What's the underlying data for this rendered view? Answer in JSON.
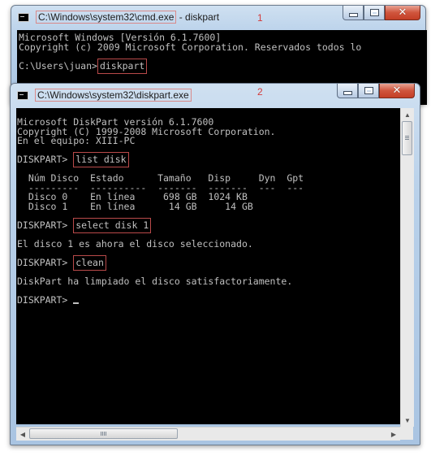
{
  "window1": {
    "marker": "1",
    "title_path": "C:\\Windows\\system32\\cmd.exe",
    "title_suffix": " - diskpart",
    "console": {
      "line1": "Microsoft Windows [Versión 6.1.7600]",
      "line2": "Copyright (c) 2009 Microsoft Corporation. Reservados todos lo",
      "prompt": "C:\\Users\\juan>",
      "command": "diskpart"
    }
  },
  "window2": {
    "marker": "2",
    "title_path": "C:\\Windows\\system32\\diskpart.exe",
    "console": {
      "header": [
        "Microsoft DiskPart versión 6.1.7600",
        "Copyright (C) 1999-2008 Microsoft Corporation.",
        "En el equipo: XIII-PC"
      ],
      "prompt": "DISKPART> ",
      "cmd1": "list disk",
      "table_header": "  Núm Disco  Estado      Tamaño   Disp     Dyn  Gpt",
      "table_rule": "  ---------  ----------  -------  -------  ---  ---",
      "table_rows": [
        "  Disco 0    En línea     698 GB  1024 KB",
        "  Disco 1    En línea      14 GB     14 GB"
      ],
      "cmd2": "select disk 1",
      "msg2": "El disco 1 es ahora el disco seleccionado.",
      "cmd3": "clean",
      "msg3": "DiskPart ha limpiado el disco satisfactoriamente.",
      "final_prompt": "DISKPART> "
    }
  },
  "colors": {
    "console_bg": "#000000",
    "console_fg": "#c0c0c0",
    "highlight_box": "#b94a4a",
    "marker": "#d43b3b"
  }
}
